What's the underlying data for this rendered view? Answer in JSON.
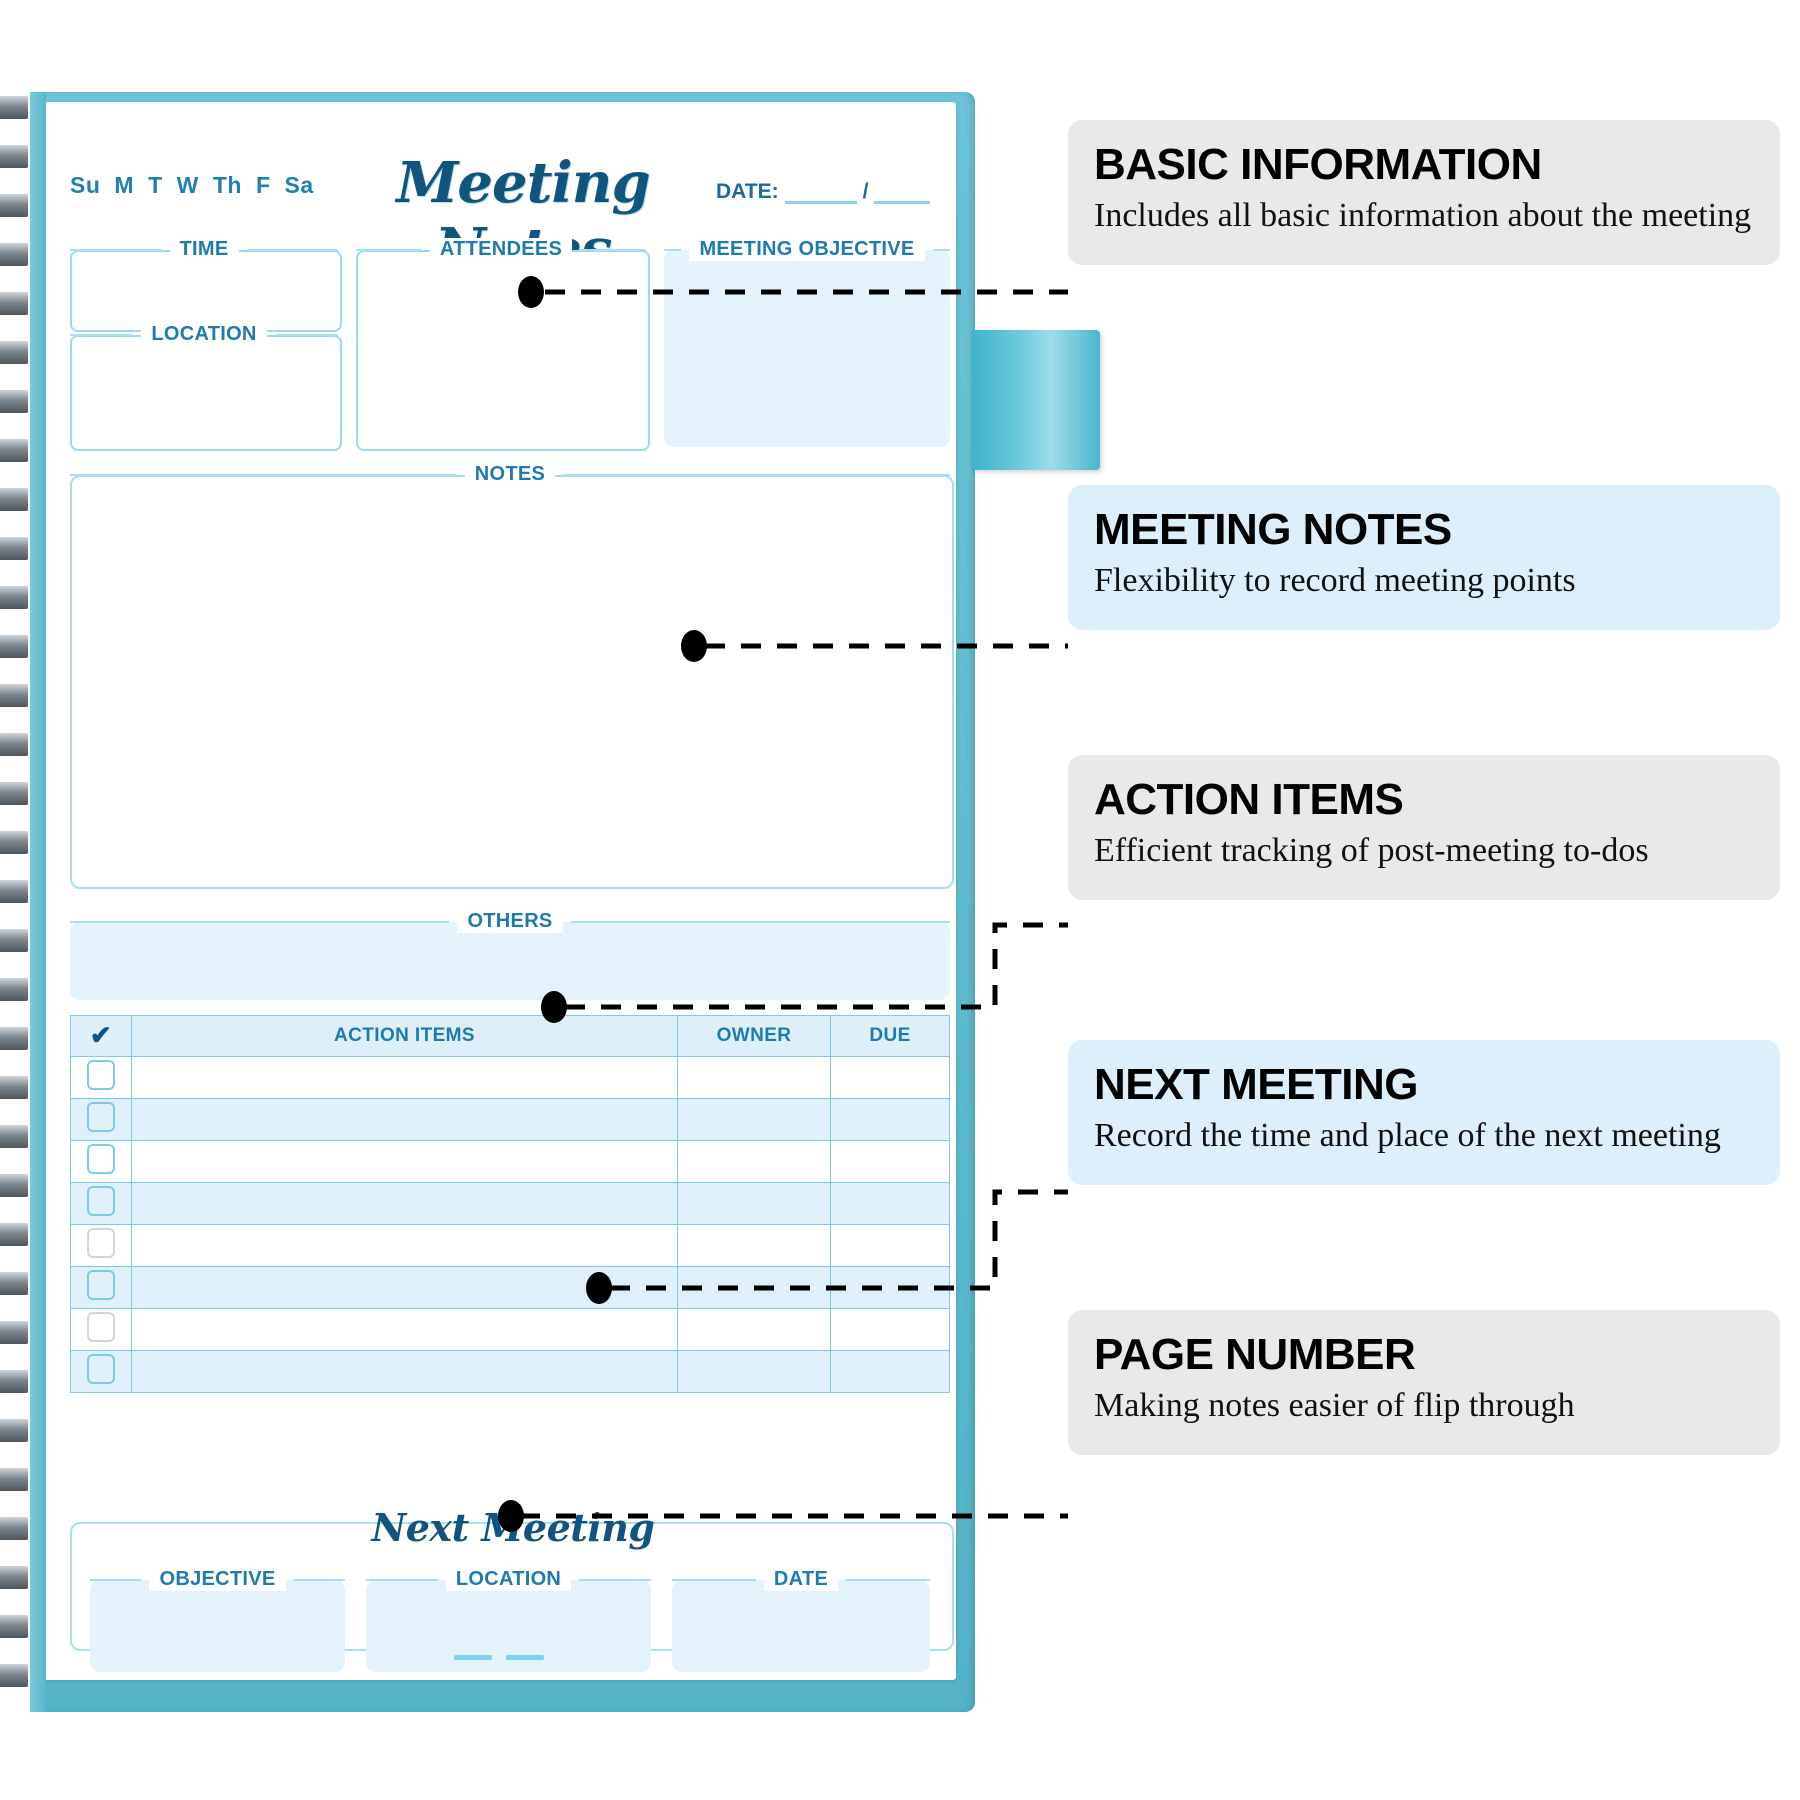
{
  "notebook": {
    "title": "Meeting Notes",
    "weekdays": [
      "Su",
      "M",
      "T",
      "W",
      "Th",
      "F",
      "Sa"
    ],
    "date_label": "DATE:",
    "date_separator": "/",
    "fields": {
      "time": "TIME",
      "location": "LOCATION",
      "attendees": "ATTENDEES",
      "objective": "MEETING OBJECTIVE",
      "notes": "NOTES",
      "others": "OTHERS"
    },
    "action_table": {
      "check_symbol": "✔",
      "headers": [
        "ACTION ITEMS",
        "OWNER",
        "DUE"
      ],
      "row_count": 8
    },
    "next_meeting": {
      "heading": "Next Meeting",
      "fields": [
        "OBJECTIVE",
        "LOCATION",
        "DATE"
      ]
    }
  },
  "callouts": [
    {
      "title": "BASIC INFORMATION",
      "body": "Includes all basic information about the meeting",
      "style": "gray"
    },
    {
      "title": "MEETING NOTES",
      "body": "Flexibility to record meeting points",
      "style": "bluebg"
    },
    {
      "title": "ACTION ITEMS",
      "body": "Efficient tracking of post-meeting to-dos",
      "style": "gray"
    },
    {
      "title": "NEXT MEETING",
      "body": "Record the time and place of the next meeting",
      "style": "bluebg"
    },
    {
      "title": "PAGE NUMBER",
      "body": "Making notes easier of flip through",
      "style": "gray"
    }
  ],
  "colors": {
    "cover_teal": "#5fbccf",
    "ink_blue": "#1d7bb0",
    "deep_blue": "#11557f",
    "fill_blue": "#e3f2fb",
    "line_blue": "#9ad9f0",
    "callout_gray": "#e9e9e9",
    "callout_blue": "#ddeffb",
    "connector_black": "#000000"
  }
}
